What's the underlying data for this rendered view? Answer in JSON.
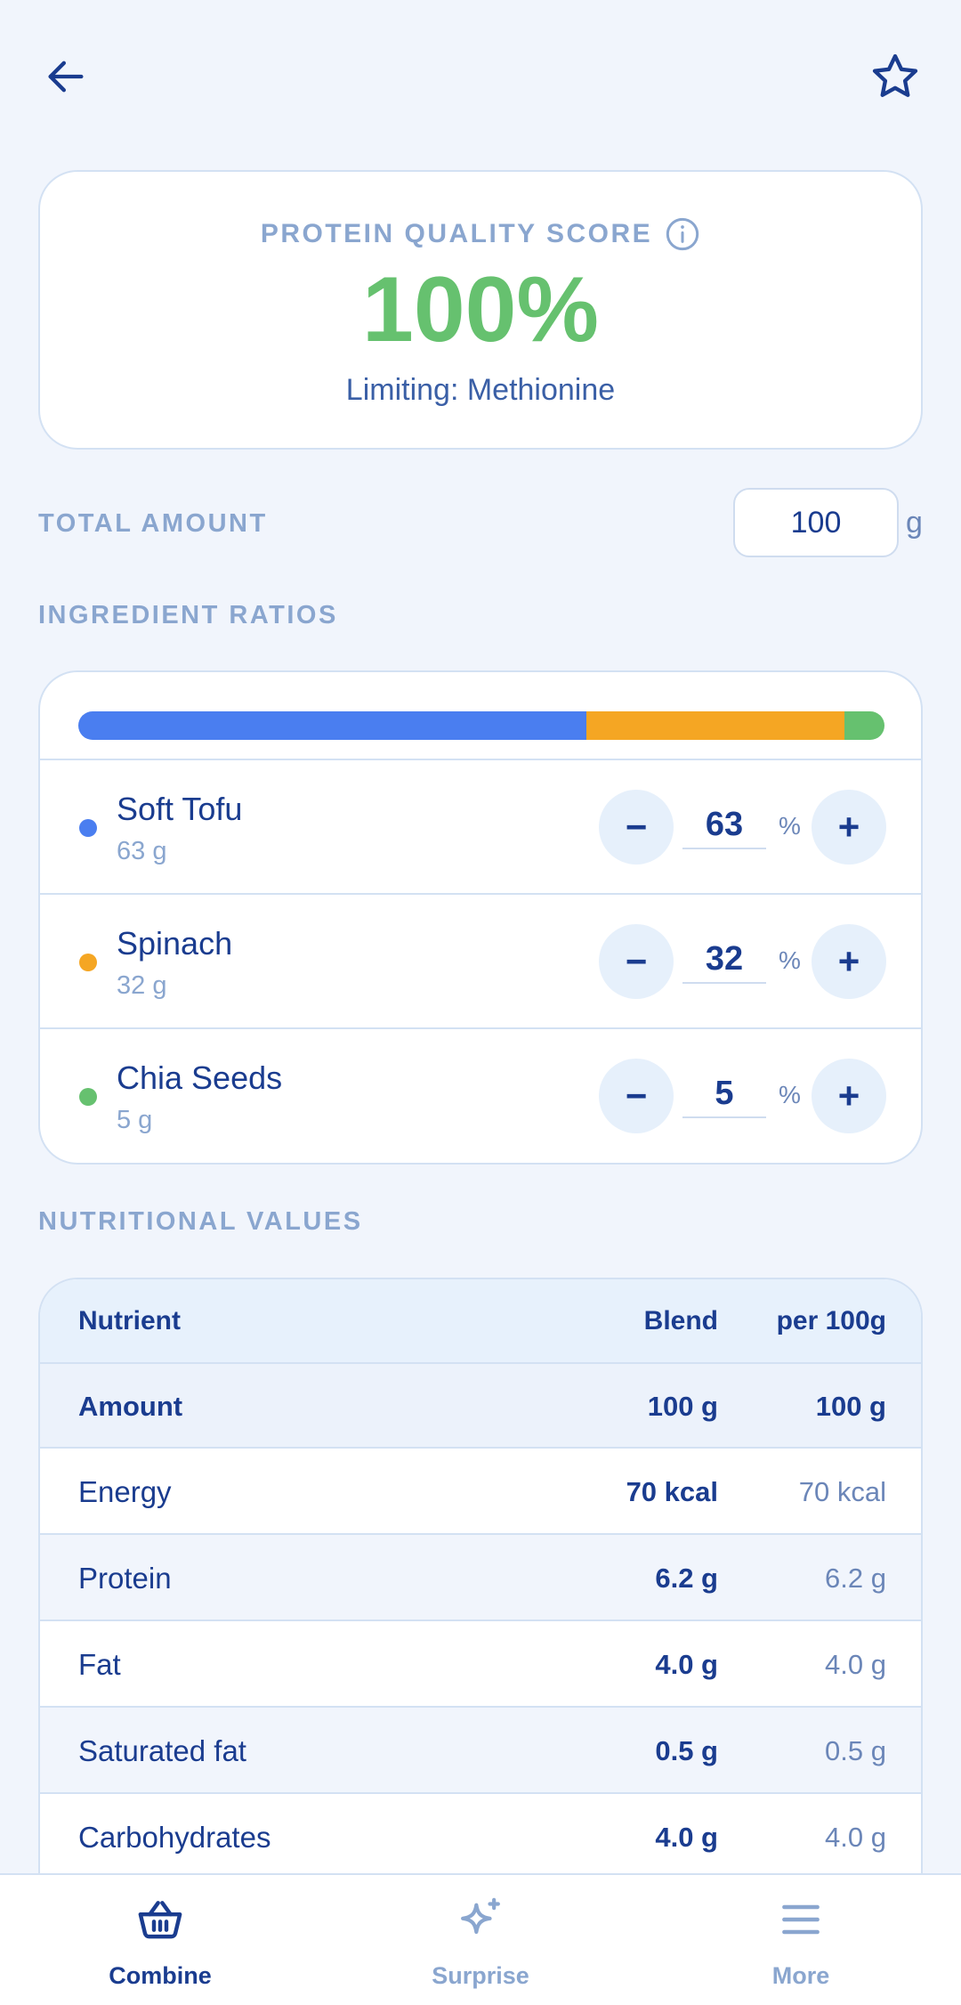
{
  "score": {
    "label": "PROTEIN QUALITY SCORE",
    "value": "100%",
    "limiting": "Limiting: Methionine"
  },
  "total": {
    "label": "TOTAL AMOUNT",
    "value": "100",
    "unit": "g"
  },
  "ratios": {
    "label": "INGREDIENT RATIOS",
    "pct_sign": "%",
    "items": [
      {
        "name": "Soft Tofu",
        "grams": "63 g",
        "percent": "63",
        "color": "#4a7ef0"
      },
      {
        "name": "Spinach",
        "grams": "32 g",
        "percent": "32",
        "color": "#f5a623"
      },
      {
        "name": "Chia Seeds",
        "grams": "5 g",
        "percent": "5",
        "color": "#66c16f"
      }
    ],
    "minus_label": "−",
    "plus_label": "+"
  },
  "nutrition": {
    "label": "NUTRITIONAL VALUES",
    "headers": {
      "name": "Nutrient",
      "blend": "Blend",
      "per": "per 100g"
    },
    "rows": [
      {
        "name": "Amount",
        "blend": "100 g",
        "per": "100 g"
      },
      {
        "name": "Energy",
        "blend": "70 kcal",
        "per": "70 kcal"
      },
      {
        "name": "Protein",
        "blend": "6.2 g",
        "per": "6.2 g"
      },
      {
        "name": "Fat",
        "blend": "4.0 g",
        "per": "4.0 g"
      },
      {
        "name": "Saturated fat",
        "blend": "0.5 g",
        "per": "0.5 g"
      },
      {
        "name": "Carbohydrates",
        "blend": "4.0 g",
        "per": "4.0 g"
      }
    ]
  },
  "nav": {
    "items": [
      {
        "label": "Combine",
        "icon": "basket-icon",
        "active": true
      },
      {
        "label": "Surprise",
        "icon": "sparkle-icon",
        "active": false
      },
      {
        "label": "More",
        "icon": "menu-icon",
        "active": false
      }
    ]
  },
  "colors": {
    "accent": "#1a3c8f",
    "score": "#66c16f",
    "muted": "#8aa6cf",
    "background": "#f1f5fc"
  }
}
